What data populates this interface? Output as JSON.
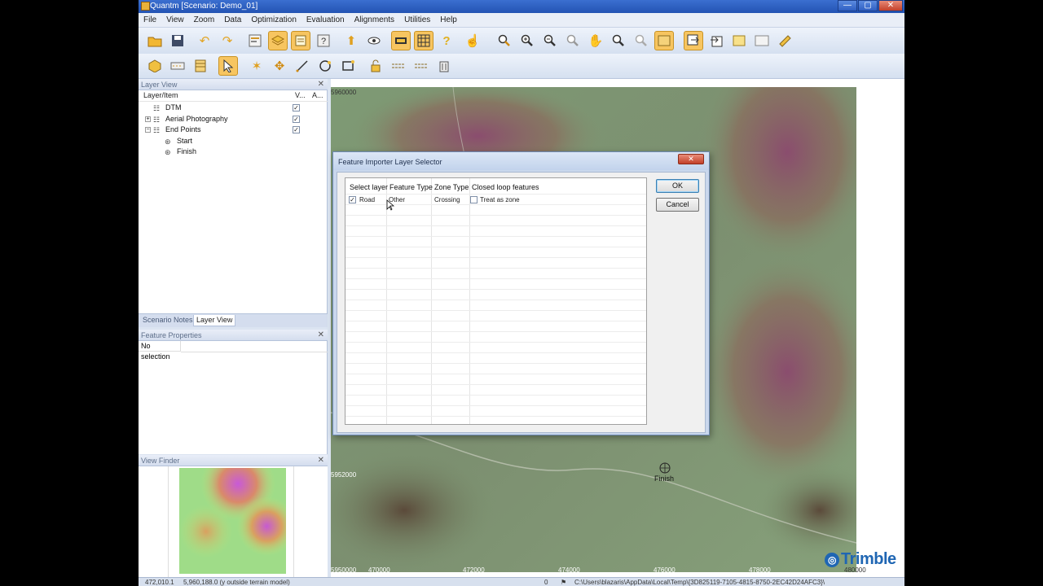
{
  "window": {
    "title": "Quantm [Scenario: Demo_01]",
    "min": "—",
    "max": "▢",
    "close": "✕"
  },
  "menu": [
    "File",
    "View",
    "Zoom",
    "Data",
    "Optimization",
    "Evaluation",
    "Alignments",
    "Utilities",
    "Help"
  ],
  "toolbar1_icons": [
    "open-folder-icon",
    "save-icon",
    "undo-icon",
    "redo-icon",
    "scenario-icon",
    "layers-icon",
    "properties-icon",
    "help-icon",
    "up-arrow-icon",
    "view-eye-icon",
    "terrain-icon",
    "grid-icon",
    "question-icon",
    "hand-pointer-icon",
    "zoom-in-icon",
    "zoom-plus-icon",
    "zoom-minus-icon",
    "zoom-extent-icon",
    "pan-hand-icon",
    "zoom-window-icon",
    "zoom-previous-icon",
    "map-frame-icon",
    "import-icon",
    "export-icon",
    "note-icon",
    "window-icon",
    "ruler-icon"
  ],
  "toolbar2_icons": [
    "box-icon",
    "road-icon",
    "table-icon",
    "select-arrow-icon",
    "star-icon",
    "move-icon",
    "line-icon",
    "circle-icon",
    "rectangle-icon",
    "lock-icon",
    "align-icon",
    "align2-icon",
    "delete-icon"
  ],
  "layer_view": {
    "title": "Layer View",
    "col_item": "Layer/Item",
    "col_v": "V...",
    "col_a": "A...",
    "rows": [
      {
        "label": "DTM",
        "checked": "✓"
      },
      {
        "label": "Aerial Photography",
        "checked": "✓"
      },
      {
        "label": "End Points",
        "checked": "✓"
      },
      {
        "label": "Start"
      },
      {
        "label": "Finish"
      }
    ],
    "tabs": [
      "Scenario Notes",
      "Layer View"
    ]
  },
  "feature_properties": {
    "title": "Feature Properties",
    "value": "No selection"
  },
  "view_finder": {
    "title": "View Finder"
  },
  "map": {
    "y_top": "5960000",
    "y_mid": "5952000",
    "y_bottom": "5950000",
    "x_labels": [
      "470000",
      "472000",
      "474000",
      "476000",
      "478000",
      "480000"
    ],
    "finish_label": "Finish"
  },
  "dialog": {
    "title": "Feature Importer Layer Selector",
    "close": "✕",
    "headers": [
      "Select layer",
      "Feature Type",
      "Zone Type",
      "Closed loop features"
    ],
    "row": {
      "checked": "✓",
      "layer": "Road",
      "feature_type": "Other",
      "zone_type": "Crossing",
      "closed_loop": "Treat as zone"
    },
    "ok": "OK",
    "cancel": "Cancel"
  },
  "status": {
    "x": "472,010.1",
    "y": "5,960,188.0 (y outside terrain model)",
    "count": "0",
    "path": "C:\\Users\\blazaris\\AppData\\Local\\Temp\\{3D825119-7105-4815-8750-2EC42D24AFC3}\\"
  },
  "brand": "Trimble",
  "colors": {
    "accent": "#f7c560",
    "title_bar": "#2353b3",
    "brand": "#1f66b3"
  }
}
